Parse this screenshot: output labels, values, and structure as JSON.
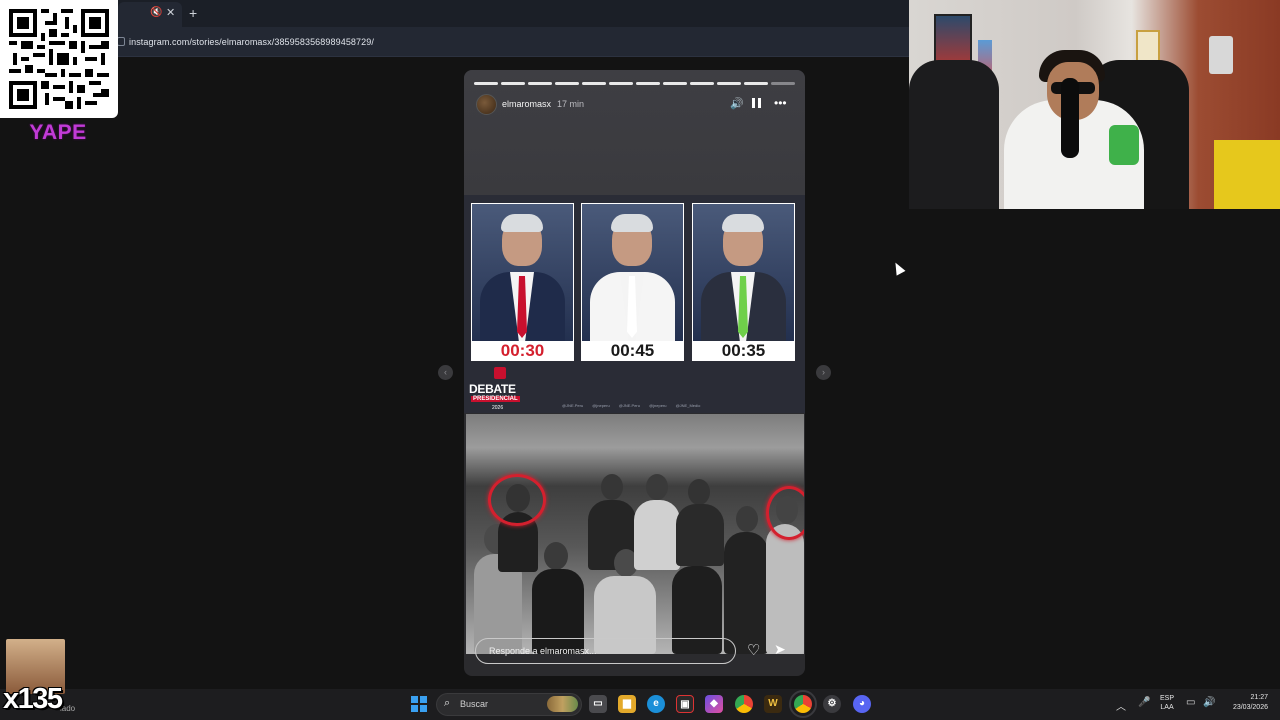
{
  "browser": {
    "url": "instagram.com/stories/elmaromasx/3859583568989458729/",
    "tab_mute_glyph": "🔇",
    "tab_close_glyph": "✕",
    "new_tab_glyph": "+"
  },
  "overlay": {
    "qr_icon": "qr-code",
    "yape_label": "YAPE",
    "multiplier": "x135",
    "corner_text": "lado"
  },
  "story": {
    "username": "elmaromasx",
    "time": "17 min",
    "progress_segments": 12,
    "progress_current": 11,
    "reply_placeholder": "Responde a elmaromasx...",
    "icons": [
      "volume-icon",
      "pause-icon",
      "more-icon",
      "heart-icon",
      "send-icon",
      "prev-arrow-icon",
      "next-arrow-icon"
    ],
    "debate": {
      "candidates": [
        {
          "timer": "00:30",
          "timer_color": "#d4202e",
          "tie_color": "#c8102e",
          "suit_color": "#1f2b4a"
        },
        {
          "timer": "00:45",
          "timer_color": "#1a1a1a",
          "tie_color": "#ffffff",
          "suit_color": "#f5f5f5"
        },
        {
          "timer": "00:35",
          "timer_color": "#1a1a1a",
          "tie_color": "#6fd04a",
          "suit_color": "#2a2f3e"
        }
      ],
      "logo_word": "DEBATE",
      "logo_sub": "PRESIDENCIAL",
      "logo_year": "2026",
      "handles": "@JNE.Peru @jneperu @JNE.Peru @jneperu @JNE_Medio"
    },
    "accent": "#d4202e"
  },
  "taskbar": {
    "search_label": "Buscar",
    "lang_top": "ESP",
    "lang_bottom": "LAA",
    "time": "21:27",
    "date": "23/03/2026",
    "apps": [
      "windows-start",
      "search",
      "file-explorer",
      "folder",
      "edge",
      "capture-app",
      "copilot",
      "chrome",
      "winamp",
      "chrome-active",
      "settings-app",
      "discord"
    ]
  }
}
